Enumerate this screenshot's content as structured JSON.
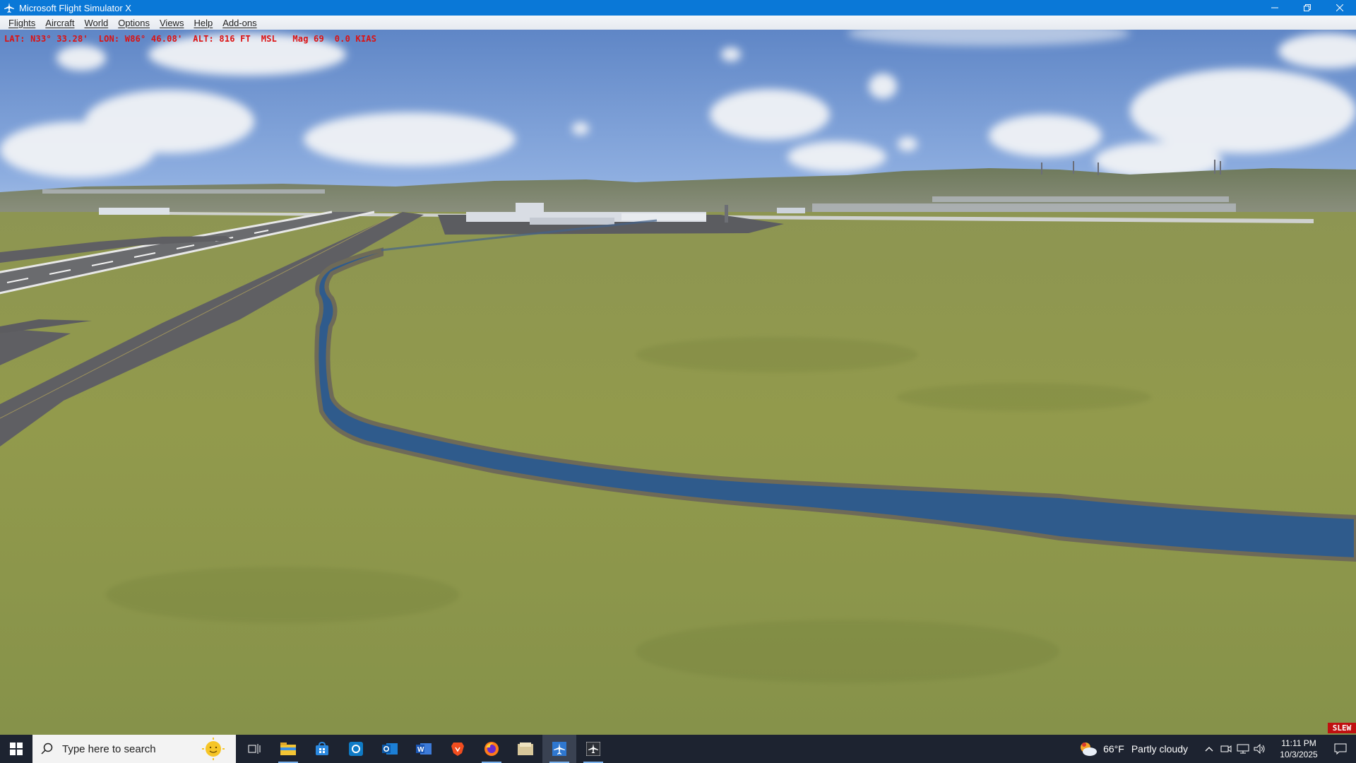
{
  "window": {
    "title": "Microsoft Flight Simulator X",
    "icon": "airplane-icon",
    "controls": [
      "minimize-icon",
      "restore-icon",
      "close-icon"
    ]
  },
  "menu": {
    "items": [
      "Flights",
      "Aircraft",
      "World",
      "Options",
      "Views",
      "Help",
      "Add-ons"
    ]
  },
  "hud": {
    "readout": "LAT: N33° 33.28'  LON: W86° 46.08'  ALT: 816 FT  MSL   Mag 69  0.0 KIAS",
    "slew_badge": "SLEW",
    "color": "#d11111"
  },
  "taskbar": {
    "search_placeholder": "Type here to search",
    "pinned": [
      {
        "name": "task-view-icon",
        "active": false,
        "running": false
      },
      {
        "name": "file-explorer-icon",
        "active": false,
        "running": true
      },
      {
        "name": "microsoft-store-icon",
        "active": false,
        "running": false
      },
      {
        "name": "edge-browser-icon",
        "active": false,
        "running": false
      },
      {
        "name": "outlook-icon",
        "active": false,
        "running": false
      },
      {
        "name": "word-icon",
        "active": false,
        "running": false
      },
      {
        "name": "brave-browser-icon",
        "active": false,
        "running": false
      },
      {
        "name": "firefox-icon",
        "active": false,
        "running": true
      },
      {
        "name": "file-manager-icon",
        "active": false,
        "running": false
      },
      {
        "name": "flight-simulator-icon",
        "active": true,
        "running": true
      },
      {
        "name": "fsx-config-icon",
        "active": false,
        "running": true
      }
    ],
    "weather": {
      "temperature": "66°F",
      "condition": "Partly cloudy"
    },
    "clock": {
      "time": "11:11 PM",
      "date": "10/3/2025"
    }
  },
  "colors": {
    "titlebar": "#0a78d7",
    "taskbar": "#1d2330",
    "sky_top": "#5f86c6",
    "grass": "#8c9a4a",
    "river": "#2f5b8c"
  }
}
